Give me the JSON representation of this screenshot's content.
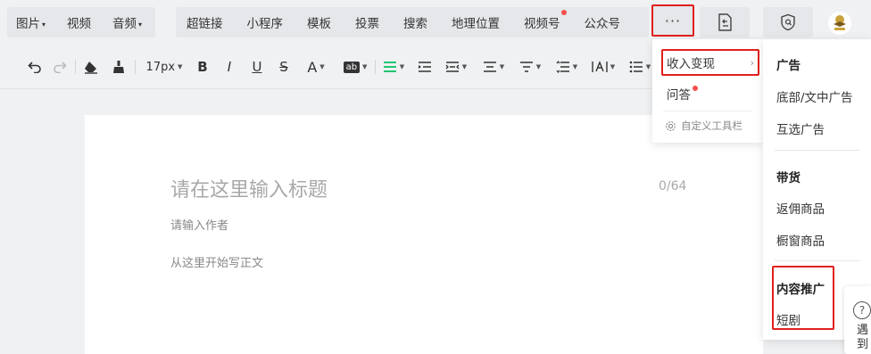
{
  "media_menu": [
    {
      "label": "图片",
      "has_caret": true
    },
    {
      "label": "视频",
      "has_caret": false
    },
    {
      "label": "音频",
      "has_caret": true
    }
  ],
  "insert_menu": [
    {
      "label": "超链接",
      "dot": false
    },
    {
      "label": "小程序",
      "dot": false
    },
    {
      "label": "模板",
      "dot": false
    },
    {
      "label": "投票",
      "dot": false
    },
    {
      "label": "搜索",
      "dot": false
    },
    {
      "label": "地理位置",
      "dot": false
    },
    {
      "label": "视频号",
      "dot": true
    },
    {
      "label": "公众号",
      "dot": false
    }
  ],
  "more_button": {
    "label": "···"
  },
  "toolbar": {
    "font_size": "17px",
    "bold": "B",
    "italic": "I",
    "underline": "U",
    "strike": "S",
    "font_color": "A",
    "bg_color": "ab"
  },
  "editor": {
    "title_placeholder": "请在这里输入标题",
    "title_count": "0/64",
    "author_placeholder": "请输入作者",
    "body_placeholder": "从这里开始写正文"
  },
  "dropdown": {
    "item_monetize": "收入变现",
    "item_qa": "问答",
    "custom_toolbar": "自定义工具栏"
  },
  "submenu": {
    "ads_heading": "广告",
    "ads_items": [
      "底部/文中广告",
      "互选广告"
    ],
    "goods_heading": "带货",
    "goods_items": [
      "返佣商品",
      "橱窗商品"
    ],
    "promo_heading": "内容推广",
    "promo_items": [
      "短剧"
    ]
  },
  "help": {
    "label": "遇到"
  },
  "colors": {
    "highlight": "#e0201c",
    "dot": "#f5504c",
    "accent_green": "#07c160"
  }
}
